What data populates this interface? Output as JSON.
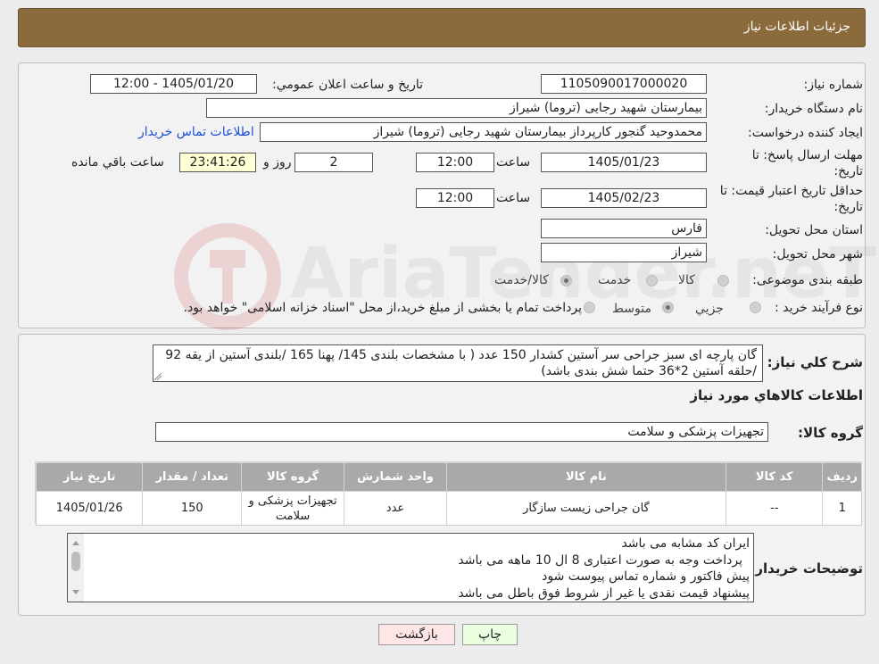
{
  "header": {
    "title": "جزئيات اطلاعات نياز"
  },
  "watermark": {
    "text": "AriaTender.neT"
  },
  "fields": {
    "need_number_label": "شماره نياز:",
    "need_number": "1105090017000020",
    "announce_label": "تاريخ و ساعت اعلان عمومي:",
    "announce_value": "1405/01/20 - 12:00",
    "buyer_org_label": "نام دستگاه خريدار:",
    "buyer_org": "بیمارستان شهید رجایی (تروما) شیراز",
    "requester_label": "ايجاد کننده درخواست:",
    "requester": "محمدوحید گنجور کارپرداز بیمارستان شهید رجایی (تروما) شیراز",
    "contact_link": "اطلاعات تماس خريدار",
    "deadline_label_1": "مهلت ارسال پاسخ: تا",
    "deadline_label_2": "تاريخ:",
    "deadline_date": "1405/01/23",
    "time_label": "ساعت",
    "deadline_time": "12:00",
    "days_value": "2",
    "days_label": "روز و",
    "remaining_time": "23:41:26",
    "remaining_label": "ساعت باقي مانده",
    "validity_label_1": "حداقل تاريخ اعتبار قيمت: تا",
    "validity_label_2": "تاريخ:",
    "validity_date": "1405/02/23",
    "validity_time": "12:00",
    "province_label": "استان محل تحويل:",
    "province": "فارس",
    "city_label": "شهر محل تحويل:",
    "city": "شیراز",
    "category_label": "طبقه بندی موضوعی:",
    "category_options": [
      "کالا",
      "خدمت",
      "کالا/خدمت"
    ],
    "process_label": "نوع فرآيند خريد :",
    "process_options": [
      "جزيي",
      "متوسط"
    ],
    "process_note": "پرداخت تمام یا بخشی از مبلغ خرید،از محل \"اسناد خزانه اسلامی\" خواهد بود."
  },
  "summary": {
    "label": "شرح كلي نياز:",
    "text": "گان پارچه ای سبز جراحی سر آستین کشدار 150 عدد ( با مشخصات بلندی 145/ پهنا 165 /بلندی آستین از یقه 92 /حلقه آستین 2*36 حتما شش بندی باشد)"
  },
  "goods_section": {
    "title": "اطلاعات كالاهاي مورد نياز",
    "group_label": "گروه كالا:",
    "group_value": "تجهیزات پزشکی و سلامت"
  },
  "table": {
    "headers": [
      "رديف",
      "كد كالا",
      "نام كالا",
      "واحد شمارش",
      "گروه كالا",
      "تعداد / مقدار",
      "تاريخ نياز"
    ],
    "rows": [
      [
        "1",
        "--",
        "گان جراحی زیست سازگار",
        "عدد",
        "تجهیزات پزشکی و سلامت",
        "150",
        "1405/01/26"
      ]
    ]
  },
  "buyer_notes": {
    "label": "توضيحات خريدار:",
    "lines": [
      "ایران کد مشابه می باشد",
      "پرداخت وجه به صورت اعتباری 8 ال 10 ماهه می باشد",
      "پیش فاکتور و شماره تماس پیوست شود",
      "پیشنهاد قیمت نقدی یا غیر از شروط فوق باطل می باشد"
    ]
  },
  "buttons": {
    "print": "چاپ",
    "back": "بازگشت"
  },
  "colors": {
    "header": "#8b6a3b",
    "print_button": "#eaffe0",
    "back_button": "#ffe6e6",
    "link": "#1a4fd6"
  }
}
